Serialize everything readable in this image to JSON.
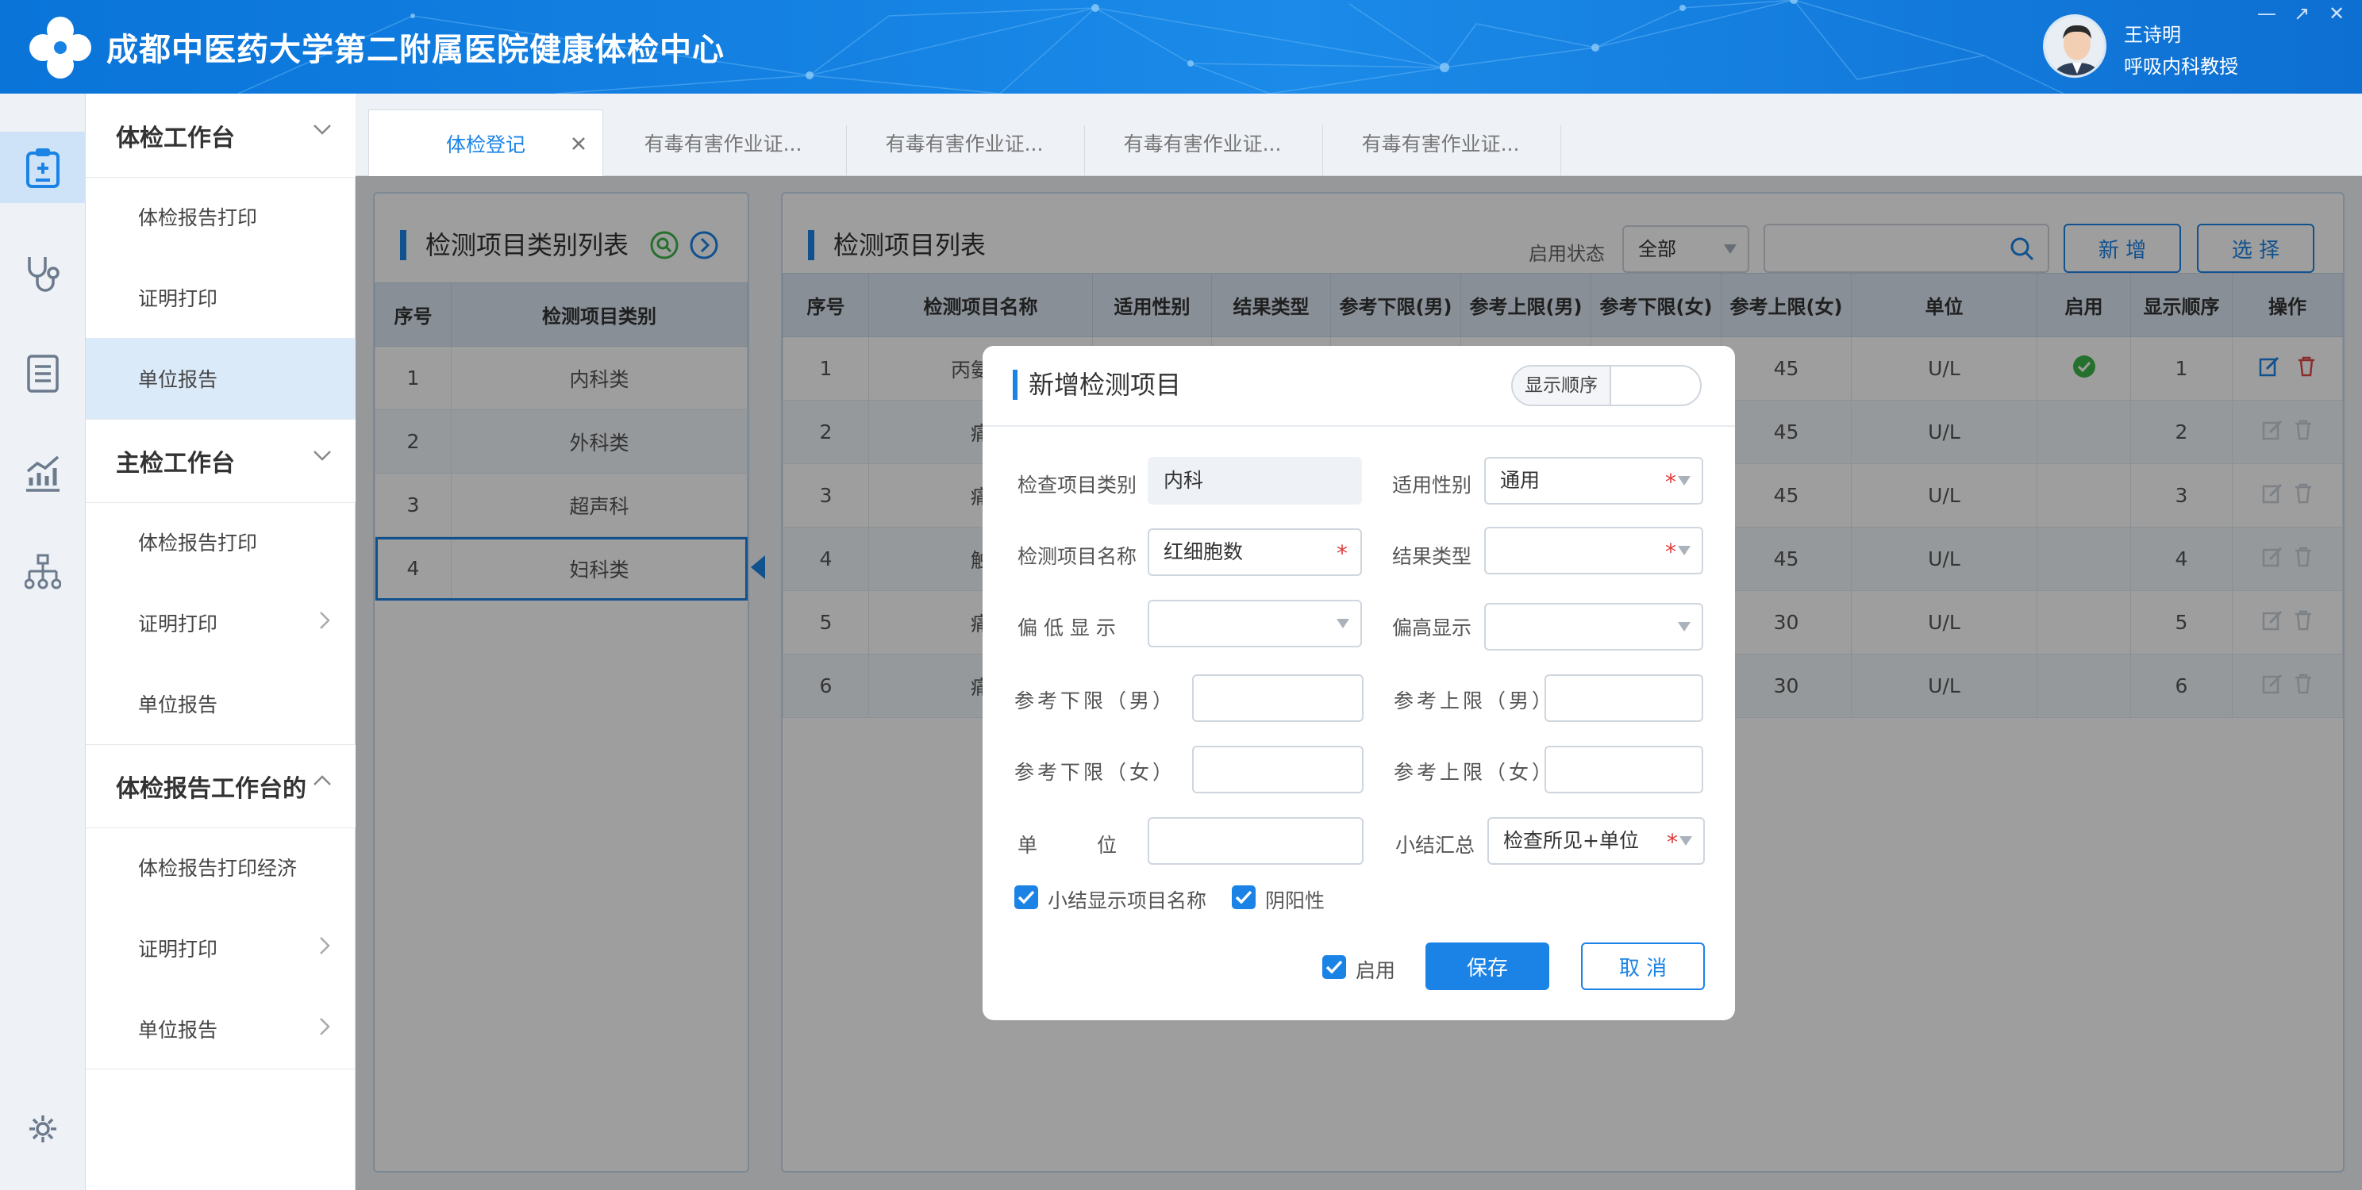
{
  "header": {
    "title": "成都中医药大学第二附属医院健康体检中心",
    "user_name": "王诗明",
    "user_role": "呼吸内科教授",
    "window_buttons": [
      "minimize-icon",
      "maximize-icon",
      "close-icon"
    ]
  },
  "rail": {
    "icons": [
      "clipboard-icon",
      "stethoscope-icon",
      "document-icon",
      "chart-icon",
      "org-tree-icon",
      "settings-icon"
    ]
  },
  "menu": {
    "groups": [
      {
        "label": "体检工作台",
        "expanded": false,
        "items": [
          {
            "label": "体检报告打印",
            "has_arrow": false
          },
          {
            "label": "证明打印",
            "has_arrow": false
          },
          {
            "label": "单位报告",
            "has_arrow": false,
            "active": true
          }
        ]
      },
      {
        "label": "主检工作台",
        "expanded": false,
        "items": [
          {
            "label": "体检报告打印",
            "has_arrow": false
          },
          {
            "label": "证明打印",
            "has_arrow": true
          },
          {
            "label": "单位报告",
            "has_arrow": false
          }
        ]
      },
      {
        "label": "体检报告工作台的",
        "expanded": true,
        "items": [
          {
            "label": "体检报告打印经济",
            "has_arrow": false
          },
          {
            "label": "证明打印",
            "has_arrow": true
          },
          {
            "label": "单位报告",
            "has_arrow": true
          }
        ]
      }
    ]
  },
  "tabs": [
    {
      "label": "体检登记",
      "active": true,
      "closable": true
    },
    {
      "label": "有毒有害作业证...",
      "active": false
    },
    {
      "label": "有毒有害作业证...",
      "active": false
    },
    {
      "label": "有毒有害作业证...",
      "active": false
    },
    {
      "label": "有毒有害作业证...",
      "active": false
    }
  ],
  "category_panel": {
    "title": "检测项目类别列表",
    "columns": [
      "序号",
      "检测项目类别"
    ],
    "rows": [
      [
        "1",
        "内科类"
      ],
      [
        "2",
        "外科类"
      ],
      [
        "3",
        "超声科"
      ],
      [
        "4",
        "妇科类"
      ]
    ],
    "selected_index": 3
  },
  "item_panel": {
    "title": "检测项目列表",
    "status_label": "启用状态",
    "status_value": "全部",
    "search_placeholder": "",
    "add_button": "新 增",
    "select_button": "选 择",
    "columns": [
      "序号",
      "检测项目名称",
      "适用性别",
      "结果类型",
      "参考下限(男)",
      "参考上限(男)",
      "参考下限(女)",
      "参考上限(女)",
      "单位",
      "启用",
      "显示顺序",
      "操作"
    ],
    "rows": [
      {
        "no": "1",
        "name": "丙氨酸",
        "ref_upper_f": "45",
        "unit": "U/L",
        "enabled": true,
        "order": "1"
      },
      {
        "no": "2",
        "name": "痛",
        "ref_upper_f": "45",
        "unit": "U/L",
        "enabled": false,
        "order": "2"
      },
      {
        "no": "3",
        "name": "痛",
        "ref_upper_f": "45",
        "unit": "U/L",
        "enabled": false,
        "order": "3"
      },
      {
        "no": "4",
        "name": "触",
        "ref_upper_f": "45",
        "unit": "U/L",
        "enabled": false,
        "order": "4"
      },
      {
        "no": "5",
        "name": "痛",
        "ref_upper_f": "30",
        "unit": "U/L",
        "enabled": false,
        "order": "5"
      },
      {
        "no": "6",
        "name": "痛",
        "ref_upper_f": "30",
        "unit": "U/L",
        "enabled": false,
        "order": "6"
      }
    ]
  },
  "dialog": {
    "title": "新增检测项目",
    "display_order_label": "显示顺序",
    "display_order_value": "",
    "fields": {
      "category_label": "检查项目类别",
      "category_value": "内科",
      "gender_label": "适用性别",
      "gender_value": "通用",
      "name_label": "检测项目名称",
      "name_value": "红细胞数",
      "result_type_label": "结果类型",
      "result_type_value": "",
      "low_display_label": "偏 低 显 示",
      "low_display_value": "",
      "high_display_label": "偏高显示",
      "high_display_value": "",
      "ref_low_m_label": "参考下限（男）",
      "ref_low_m_value": "",
      "ref_high_m_label": "参考上限（男）",
      "ref_high_m_value": "",
      "ref_low_f_label": "参考下限（女）",
      "ref_low_f_value": "",
      "ref_high_f_label": "参考上限（女）",
      "ref_high_f_value": "",
      "unit_label": "单　　　位",
      "unit_value": "",
      "summary_label": "小结汇总",
      "summary_value": "检查所见+单位"
    },
    "checks": {
      "show_name_label": "小结显示项目名称",
      "show_name_checked": true,
      "yinyang_label": "阴阳性",
      "yinyang_checked": true,
      "enable_label": "启用",
      "enable_checked": true
    },
    "save_button": "保存",
    "cancel_button": "取 消"
  },
  "colors": {
    "primary": "#1b83e6",
    "header": "#1683e4",
    "required": "#e03b3b",
    "enabled_icon": "#3cb54a",
    "delete_icon": "#e04848"
  }
}
